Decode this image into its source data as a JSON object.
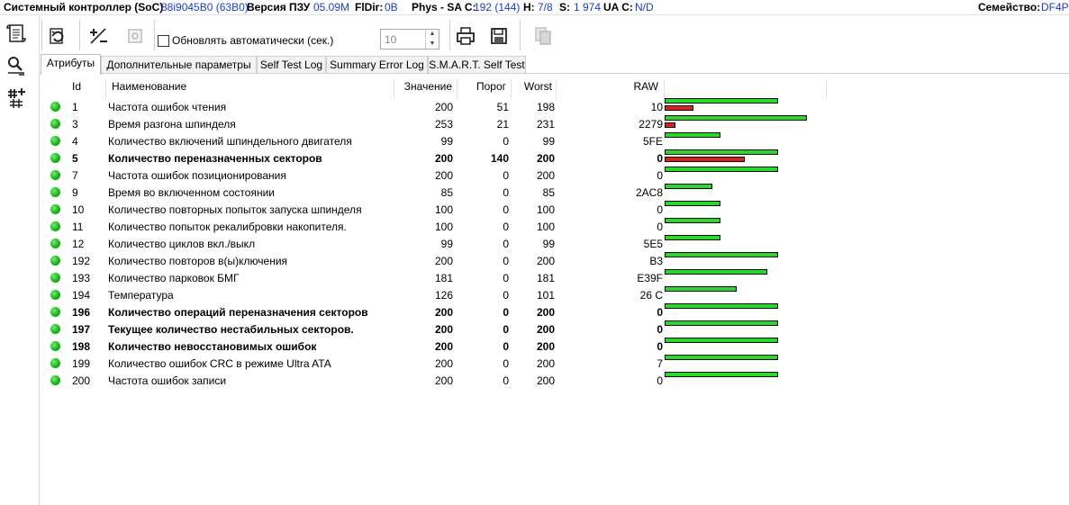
{
  "info": {
    "controller_label": "Системный контроллер (SoC)",
    "controller_value": "88i9045B0 (63B0)",
    "fw_label": "Версия ПЗУ",
    "fw_value": "05.09M",
    "fldir_label": "FlDir:",
    "fldir_value": "0B",
    "phys_label": "Phys - SA C:",
    "phys_value": "192 (144)",
    "h_label": "H:",
    "h_value": "7/8",
    "s_label": "S:",
    "s_value": "1 974",
    "ua_label": "UA C:",
    "ua_value": "N/D",
    "family_label": "Семейство:",
    "family_value": "DF4PL"
  },
  "toolbar": {
    "auto_update_label": "Обновлять автоматически (сек.)",
    "auto_update_checked": false,
    "interval_value": "10",
    "icons": [
      "refresh-icon",
      "percent-icon",
      "settings-icon",
      "print-icon",
      "save-icon",
      "copy-icon"
    ]
  },
  "left_toolbar": {
    "icons": [
      "smart-scroll-icon",
      "search-key-icon",
      "hash-plus-icon"
    ]
  },
  "tabs": [
    {
      "label": "Атрибуты",
      "active": true
    },
    {
      "label": "Дополнительные параметры",
      "active": false
    },
    {
      "label": "Self Test Log",
      "active": false
    },
    {
      "label": "Summary Error Log",
      "active": false
    },
    {
      "label": "S.M.A.R.T. Self Test",
      "active": false
    }
  ],
  "table": {
    "headers": {
      "id": "Id",
      "name": "Наименование",
      "value": "Значение",
      "threshold": "Порог",
      "worst": "Worst",
      "raw": "RAW"
    },
    "colors": {
      "status": "#19b519",
      "bar_good": "#1fe01f",
      "bar_bad": "#e31b1b"
    },
    "rows": [
      {
        "id": "1",
        "name": "Частота ошибок чтения",
        "value": "200",
        "threshold": "51",
        "worst": "198",
        "raw": "10",
        "bold": false,
        "green_level": 0.71,
        "red_level": 0.18
      },
      {
        "id": "3",
        "name": "Время разгона шпинделя",
        "value": "253",
        "threshold": "21",
        "worst": "231",
        "raw": "2279",
        "bold": false,
        "green_level": 0.89,
        "red_level": 0.07
      },
      {
        "id": "4",
        "name": "Количество включений шпиндельного двигателя",
        "value": "99",
        "threshold": "0",
        "worst": "99",
        "raw": "5FE",
        "bold": false,
        "green_level": 0.35,
        "red_level": 0
      },
      {
        "id": "5",
        "name": "Количество переназначенных секторов",
        "value": "200",
        "threshold": "140",
        "worst": "200",
        "raw": "0",
        "bold": true,
        "green_level": 0.71,
        "red_level": 0.5
      },
      {
        "id": "7",
        "name": "Частота ошибок позиционирования",
        "value": "200",
        "threshold": "0",
        "worst": "200",
        "raw": "0",
        "bold": false,
        "green_level": 0.71,
        "red_level": 0
      },
      {
        "id": "9",
        "name": "Время во включенном состоянии",
        "value": "85",
        "threshold": "0",
        "worst": "85",
        "raw": "2AC8",
        "bold": false,
        "green_level": 0.3,
        "red_level": 0
      },
      {
        "id": "10",
        "name": "Количество повторных попыток запуска шпинделя",
        "value": "100",
        "threshold": "0",
        "worst": "100",
        "raw": "0",
        "bold": false,
        "green_level": 0.35,
        "red_level": 0
      },
      {
        "id": "11",
        "name": "Количество попыток рекалибровки накопителя.",
        "value": "100",
        "threshold": "0",
        "worst": "100",
        "raw": "0",
        "bold": false,
        "green_level": 0.35,
        "red_level": 0
      },
      {
        "id": "12",
        "name": "Количество циклов вкл./выкл",
        "value": "99",
        "threshold": "0",
        "worst": "99",
        "raw": "5E5",
        "bold": false,
        "green_level": 0.35,
        "red_level": 0
      },
      {
        "id": "192",
        "name": "Количество повторов в(ы)ключения",
        "value": "200",
        "threshold": "0",
        "worst": "200",
        "raw": "B3",
        "bold": false,
        "green_level": 0.71,
        "red_level": 0
      },
      {
        "id": "193",
        "name": "Количество парковок БМГ",
        "value": "181",
        "threshold": "0",
        "worst": "181",
        "raw": "E39F",
        "bold": false,
        "green_level": 0.64,
        "red_level": 0
      },
      {
        "id": "194",
        "name": "Температура",
        "value": "126",
        "threshold": "0",
        "worst": "101",
        "raw": "26 C",
        "bold": false,
        "green_level": 0.45,
        "red_level": 0
      },
      {
        "id": "196",
        "name": "Количество операций переназначения секторов",
        "value": "200",
        "threshold": "0",
        "worst": "200",
        "raw": "0",
        "bold": true,
        "green_level": 0.71,
        "red_level": 0
      },
      {
        "id": "197",
        "name": "Текущее количество нестабильных секторов.",
        "value": "200",
        "threshold": "0",
        "worst": "200",
        "raw": "0",
        "bold": true,
        "green_level": 0.71,
        "red_level": 0
      },
      {
        "id": "198",
        "name": "Количество невосстановимых ошибок",
        "value": "200",
        "threshold": "0",
        "worst": "200",
        "raw": "0",
        "bold": true,
        "green_level": 0.71,
        "red_level": 0
      },
      {
        "id": "199",
        "name": "Количество ошибок CRC в режиме Ultra ATA",
        "value": "200",
        "threshold": "0",
        "worst": "200",
        "raw": "7",
        "bold": false,
        "green_level": 0.71,
        "red_level": 0
      },
      {
        "id": "200",
        "name": "Частота ошибок записи",
        "value": "200",
        "threshold": "0",
        "worst": "200",
        "raw": "0",
        "bold": false,
        "green_level": 0.71,
        "red_level": 0
      }
    ]
  }
}
